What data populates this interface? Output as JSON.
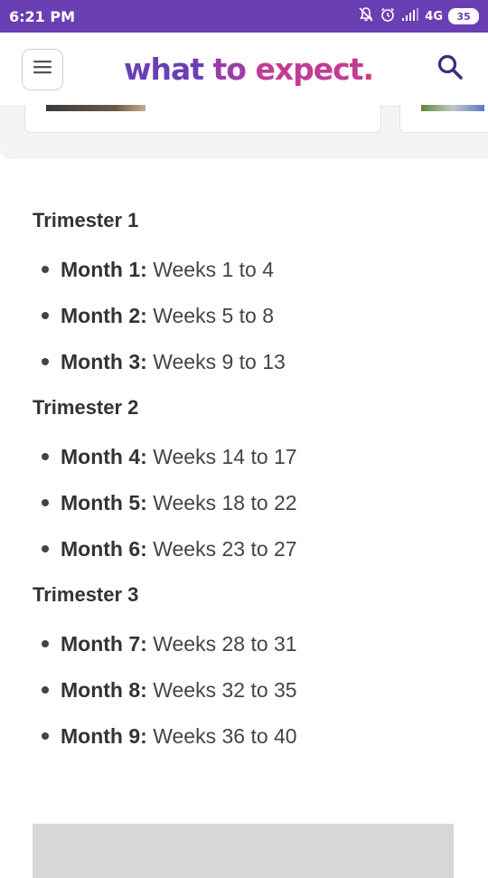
{
  "status_bar": {
    "time": "6:21 PM",
    "network": "4G",
    "battery": "35",
    "mute_icon": "mute-bell-icon",
    "alarm_icon": "alarm-icon",
    "signal_icon": "signal-bars-icon"
  },
  "header": {
    "logo": {
      "part1": "what ",
      "part2": "to ",
      "part3": "expect",
      "dot": "."
    },
    "menu_icon": "hamburger-menu-icon",
    "search_icon": "search-icon"
  },
  "colors": {
    "status_bar": "#6a3fb4",
    "logo_purple": "#6b3fb4",
    "logo_magenta": "#c13c94",
    "text": "#333333"
  },
  "trimesters": [
    {
      "title": "Trimester 1",
      "months": [
        {
          "label": "Month 1:",
          "weeks": " Weeks 1 to 4"
        },
        {
          "label": "Month 2:",
          "weeks": " Weeks 5 to 8"
        },
        {
          "label": "Month 3:",
          "weeks": " Weeks 9 to 13"
        }
      ]
    },
    {
      "title": "Trimester 2",
      "months": [
        {
          "label": "Month 4:",
          "weeks": " Weeks 14 to 17"
        },
        {
          "label": "Month 5:",
          "weeks": " Weeks 18 to 22"
        },
        {
          "label": "Month 6:",
          "weeks": " Weeks 23 to 27"
        }
      ]
    },
    {
      "title": "Trimester 3",
      "months": [
        {
          "label": "Month 7:",
          "weeks": " Weeks 28 to 31"
        },
        {
          "label": "Month 8:",
          "weeks": " Weeks 32 to 35"
        },
        {
          "label": "Month 9:",
          "weeks": " Weeks 36 to 40"
        }
      ]
    }
  ]
}
